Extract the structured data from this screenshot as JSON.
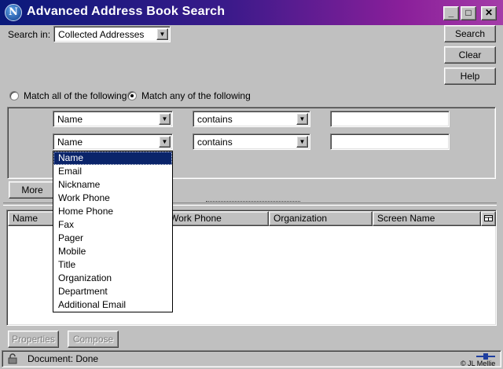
{
  "window": {
    "title": "Advanced Address Book Search",
    "icon_letter": "N"
  },
  "titlebar_buttons": {
    "minimize": "_",
    "maximize": "□",
    "close": "✕"
  },
  "search_in": {
    "label": "Search in:",
    "value": "Collected Addresses"
  },
  "buttons": {
    "search": "Search",
    "clear": "Clear",
    "help": "Help",
    "more": "More",
    "properties": "Properties",
    "compose": "Compose"
  },
  "match": {
    "all_label": "Match all of the following",
    "any_label": "Match any of the following",
    "selected": "any"
  },
  "criteria": [
    {
      "field": "Name",
      "operator": "contains",
      "value": ""
    },
    {
      "field": "Name",
      "operator": "contains",
      "value": ""
    }
  ],
  "dropdown_options": [
    "Name",
    "Email",
    "Nickname",
    "Work Phone",
    "Home Phone",
    "Fax",
    "Pager",
    "Mobile",
    "Title",
    "Organization",
    "Department",
    "Additional Email"
  ],
  "dropdown_selected": "Name",
  "results": {
    "columns": [
      "Name",
      "Work Phone",
      "Organization",
      "Screen Name"
    ]
  },
  "status": {
    "text": "Document: Done",
    "copyright": "© JL Mellie"
  },
  "arrow_glyph": "▼"
}
